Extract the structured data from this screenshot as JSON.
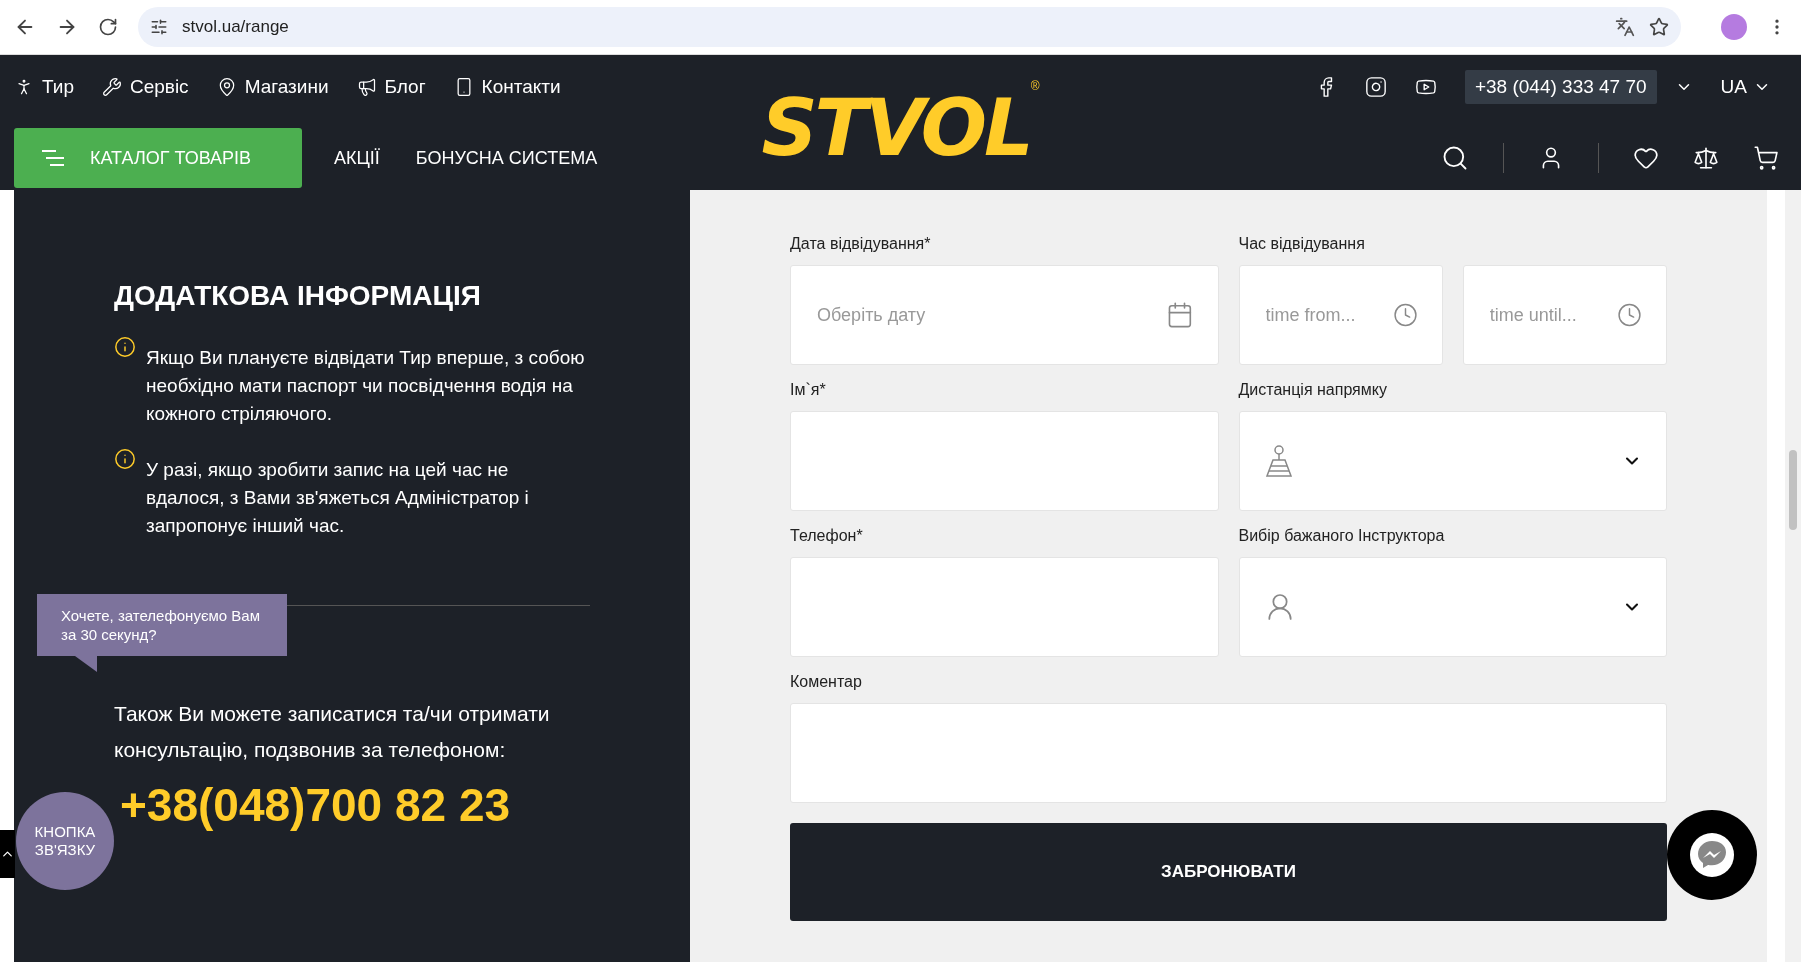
{
  "browser": {
    "url": "stvol.ua/range"
  },
  "header": {
    "top_links": [
      {
        "label": "Тир"
      },
      {
        "label": "Сервіс"
      },
      {
        "label": "Магазини"
      },
      {
        "label": "Блог"
      },
      {
        "label": "Контакти"
      }
    ],
    "logo": {
      "text": "STVOL",
      "mark": "®"
    },
    "phone": "+38 (044) 333 47 70",
    "language": "UA",
    "catalog_button": "КАТАЛОГ ТОВАРІВ",
    "nav": [
      "АКЦІЇ",
      "БОНУСНА СИСТЕМА"
    ]
  },
  "info": {
    "title": "ДОДАТКОВА ІНФОРМАЦІЯ",
    "notes": [
      "Якщо Ви плануєте відвідати Тир вперше, з собою необхідно мати паспорт чи посвідчення водія на кожного стріляючого.",
      "У разі, якщо зробити запис на цей час не вдалося, з Вами зв'яжеться Адміністратор і запропонує інший час."
    ],
    "contact_text": "Також Ви можете записатися та/чи отримати консультацію, подзвонив за телефоном:",
    "phone": "+38(048)700 82 23"
  },
  "form": {
    "rows": [
      [
        {
          "kind": "date",
          "label": "Дата відвідування*",
          "placeholder": "Оберіть дату"
        },
        {
          "kind": "time",
          "label": "Час відвідування",
          "placeholders": [
            "time from...",
            "time until..."
          ]
        }
      ],
      [
        {
          "kind": "text",
          "label": "Ім`я*"
        },
        {
          "kind": "select",
          "label": "Дистанція напрямку"
        }
      ],
      [
        {
          "kind": "text",
          "label": "Телефон*"
        },
        {
          "kind": "select",
          "label": "Вибір бажаного Інструктора"
        }
      ],
      [
        {
          "kind": "textarea",
          "label": "Коментар"
        }
      ]
    ],
    "submit": "ЗАБРОНЮВАТИ"
  },
  "callback": {
    "tooltip": "Хочете, зателефонуємо Вам за 30 секунд?",
    "button": "КНОПКА ЗВ'ЯЗКУ"
  }
}
